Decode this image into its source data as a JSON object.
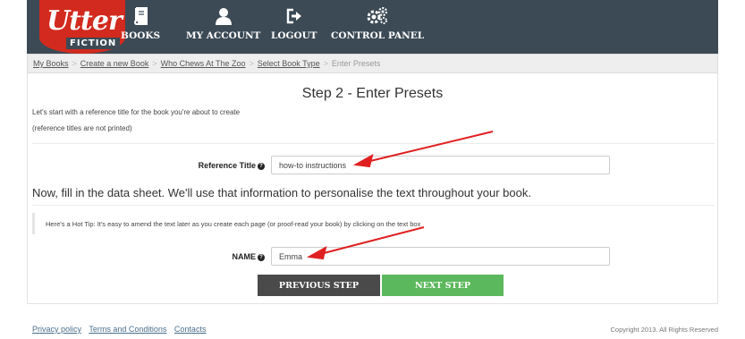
{
  "brand": {
    "logo_main": "Utter",
    "logo_sub": "FICTION",
    "accent": "#d22a1e",
    "nav_bg": "#3c4a55"
  },
  "nav": {
    "items": [
      {
        "label": "BOOKS",
        "icon": "book-icon"
      },
      {
        "label": "MY ACCOUNT",
        "icon": "user-icon"
      },
      {
        "label": "LOGOUT",
        "icon": "logout-icon"
      },
      {
        "label": "CONTROL PANEL",
        "icon": "gears-icon"
      }
    ]
  },
  "breadcrumb": {
    "items": [
      "My Books",
      "Create a new Book",
      "Who Chews At The Zoo",
      "Select Book Type"
    ],
    "current": "Enter Presets",
    "separator": ">"
  },
  "page": {
    "title": "Step 2 - Enter Presets",
    "intro_line1": "Let's start with a reference title for the book you're about to create",
    "intro_line2": "(reference titles are not printed)"
  },
  "reference": {
    "label": "Reference Title",
    "help": "?",
    "value": "how-to instructions"
  },
  "datasheet": {
    "heading": "Now, fill in the data sheet. We'll use that information to personalise the text throughout your book.",
    "tip": "Here's a Hot Tip: It's easy to amend the text later as you create each page (or proof-read your book) by clicking on the text box"
  },
  "name_field": {
    "label": "NAME",
    "help": "?",
    "value": "Emma"
  },
  "buttons": {
    "previous": "PREVIOUS STEP",
    "next": "NEXT STEP",
    "previous_color": "#4a4a4a",
    "next_color": "#5cb85c"
  },
  "footer": {
    "links": [
      "Privacy policy",
      "Terms and Conditions",
      "Contacts"
    ],
    "copyright": "Copyright 2013. All Rights Reserved"
  },
  "annotation_color": "#e02020"
}
